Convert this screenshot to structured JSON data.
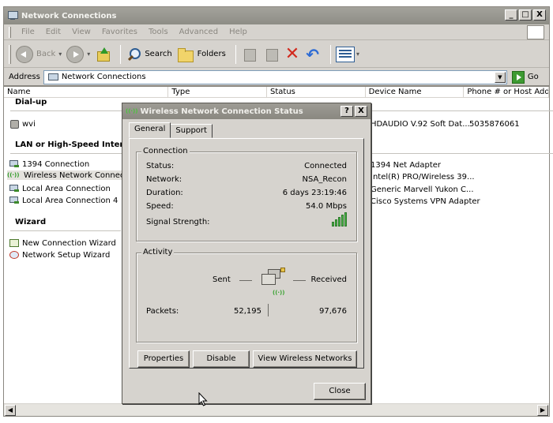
{
  "window": {
    "title": "Network Connections",
    "controls": [
      "_",
      "□",
      "X"
    ]
  },
  "menubar": {
    "items": [
      "File",
      "Edit",
      "View",
      "Favorites",
      "Tools",
      "Advanced",
      "Help"
    ]
  },
  "toolbar": {
    "back": "Back",
    "search": "Search",
    "folders": "Folders"
  },
  "address": {
    "label": "Address",
    "value": "Network Connections",
    "go": "Go"
  },
  "columns": [
    "Name",
    "Type",
    "Status",
    "Device Name",
    "Phone # or Host Addre"
  ],
  "groups": {
    "dialup": "Dial-up",
    "lan": "LAN or High-Speed Internet",
    "wizard": "Wizard"
  },
  "dialup_items": [
    {
      "name": "wvi",
      "device": "HDAUDIO V.92 Soft Dat...",
      "phone": "5035876061"
    }
  ],
  "lan_items": [
    {
      "name": "1394 Connection",
      "device": "1394 Net Adapter"
    },
    {
      "name": "Wireless Network Connection",
      "device": "Intel(R) PRO/Wireless 39..."
    },
    {
      "name": "Local Area Connection",
      "device": "Generic Marvell Yukon C..."
    },
    {
      "name": "Local Area Connection 4",
      "device": "Cisco Systems VPN Adapter"
    }
  ],
  "wizard_items": [
    {
      "name": "New Connection Wizard"
    },
    {
      "name": "Network Setup Wizard"
    }
  ],
  "dialog": {
    "title": "Wireless Network Connection Status",
    "controls": [
      "?",
      "X"
    ],
    "tabs": [
      "General",
      "Support"
    ],
    "connection": {
      "label": "Connection",
      "status_label": "Status:",
      "status_value": "Connected",
      "network_label": "Network:",
      "network_value": "NSA_Recon",
      "duration_label": "Duration:",
      "duration_value": "6 days 23:19:46",
      "speed_label": "Speed:",
      "speed_value": "54.0 Mbps",
      "signal_label": "Signal Strength:",
      "signal_bars": 5
    },
    "activity": {
      "label": "Activity",
      "sent_label": "Sent",
      "received_label": "Received",
      "packets_label": "Packets:",
      "sent_packets": "52,195",
      "received_packets": "97,676"
    },
    "buttons": {
      "properties": "Properties",
      "disable": "Disable",
      "view_wireless": "View Wireless Networks",
      "close": "Close"
    }
  },
  "colors": {
    "titlebar": "#8e8d86",
    "face": "#d6d3ce",
    "signal": "#4ab548"
  }
}
